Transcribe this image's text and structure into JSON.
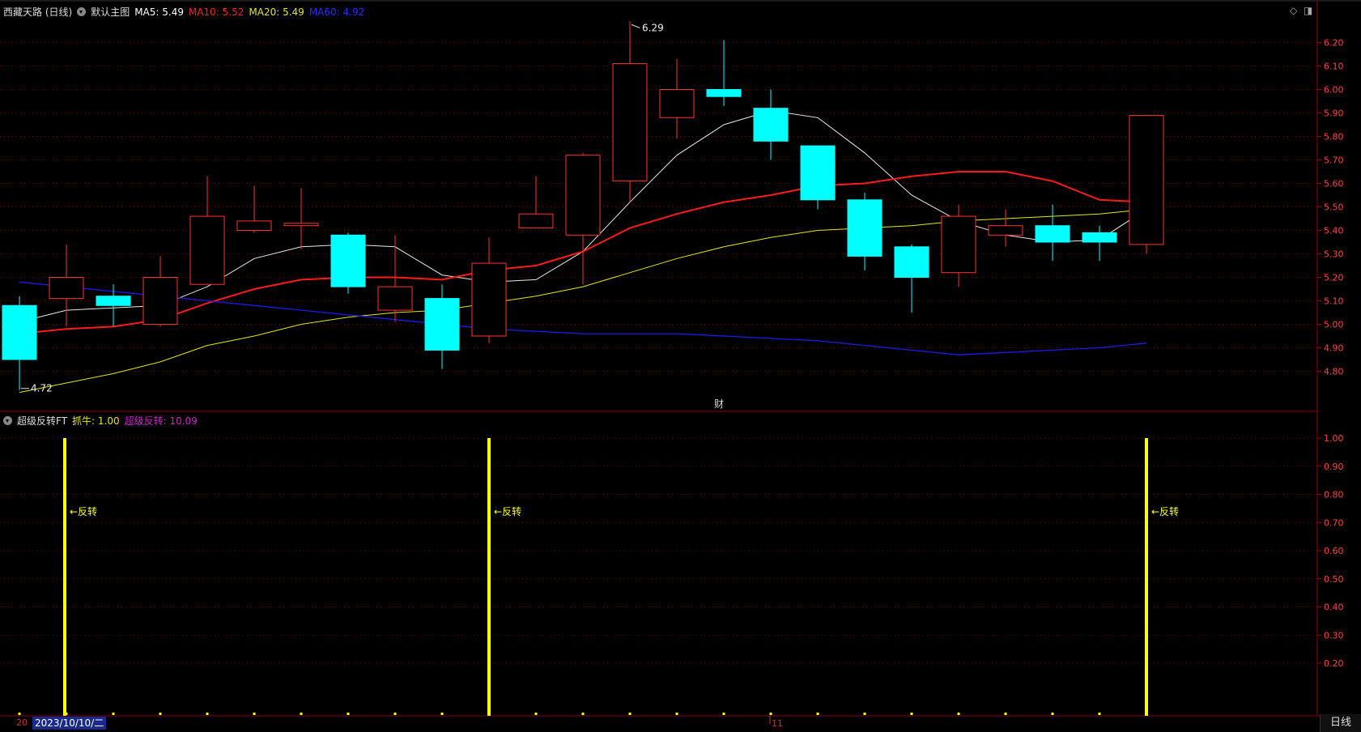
{
  "header": {
    "stock_name": "西藏天路 (日线)",
    "main_chart_label": "默认主图",
    "ma5": {
      "label": "MA5: 5.49",
      "color": "#ffffff"
    },
    "ma10": {
      "label": "MA10: 5.52",
      "color": "#ff2020"
    },
    "ma20": {
      "label": "MA20: 5.49",
      "color": "#e6e600"
    },
    "ma60": {
      "label": "MA60: 4.92",
      "color": "#1a1aff"
    }
  },
  "indicator_header": {
    "name": "超级反转FT",
    "zhuaniu": {
      "label": "抓牛: 1.00",
      "color": "#e6e600"
    },
    "chaoji": {
      "label": "超级反转: 10.09",
      "color": "#d020d0"
    }
  },
  "marks": {
    "high_label": "6.29",
    "low_label": "4.72",
    "cai_label": "财",
    "reversal_label": "←反转",
    "month_tick": "11"
  },
  "footer": {
    "date_prefix": "20",
    "selected_date": "2023/10/10/二",
    "period": "日线"
  },
  "colors": {
    "up": "#ff3030",
    "down": "#00ffff",
    "grid": "#7a0000",
    "axis_text": "#ff4040",
    "indicator_bar": "#ffff00"
  },
  "chart_data": {
    "type": "candlestick",
    "price_axis": {
      "ticks": [
        "6.20",
        "6.10",
        "6.00",
        "5.90",
        "5.80",
        "5.70",
        "5.60",
        "5.50",
        "5.40",
        "5.30",
        "5.20",
        "5.10",
        "5.00",
        "4.90",
        "4.80"
      ]
    },
    "candles": [
      {
        "open": 5.08,
        "close": 4.85,
        "high": 5.12,
        "low": 4.72
      },
      {
        "open": 5.11,
        "close": 5.2,
        "high": 5.34,
        "low": 4.99
      },
      {
        "open": 5.12,
        "close": 5.08,
        "high": 5.17,
        "low": 4.99
      },
      {
        "open": 5.0,
        "close": 5.2,
        "high": 5.29,
        "low": 4.99
      },
      {
        "open": 5.17,
        "close": 5.46,
        "high": 5.63,
        "low": 5.17
      },
      {
        "open": 5.4,
        "close": 5.44,
        "high": 5.59,
        "low": 5.39
      },
      {
        "open": 5.42,
        "close": 5.43,
        "high": 5.58,
        "low": 5.32
      },
      {
        "open": 5.38,
        "close": 5.16,
        "high": 5.39,
        "low": 5.13
      },
      {
        "open": 5.06,
        "close": 5.16,
        "high": 5.38,
        "low": 5.01
      },
      {
        "open": 5.11,
        "close": 4.89,
        "high": 5.17,
        "low": 4.81
      },
      {
        "open": 4.95,
        "close": 5.26,
        "high": 5.37,
        "low": 4.92
      },
      {
        "open": 5.41,
        "close": 5.47,
        "high": 5.63,
        "low": 5.41
      },
      {
        "open": 5.38,
        "close": 5.72,
        "high": 5.73,
        "low": 5.17
      },
      {
        "open": 5.61,
        "close": 6.11,
        "high": 6.29,
        "low": 5.52
      },
      {
        "open": 5.88,
        "close": 6.0,
        "high": 6.13,
        "low": 5.79
      },
      {
        "open": 6.0,
        "close": 5.97,
        "high": 6.21,
        "low": 5.93
      },
      {
        "open": 5.92,
        "close": 5.78,
        "high": 6.0,
        "low": 5.7
      },
      {
        "open": 5.76,
        "close": 5.53,
        "high": 5.76,
        "low": 5.49
      },
      {
        "open": 5.53,
        "close": 5.29,
        "high": 5.56,
        "low": 5.23
      },
      {
        "open": 5.33,
        "close": 5.2,
        "high": 5.34,
        "low": 5.05
      },
      {
        "open": 5.22,
        "close": 5.46,
        "high": 5.51,
        "low": 5.16
      },
      {
        "open": 5.38,
        "close": 5.42,
        "high": 5.49,
        "low": 5.33
      },
      {
        "open": 5.42,
        "close": 5.35,
        "high": 5.51,
        "low": 5.27
      },
      {
        "open": 5.39,
        "close": 5.35,
        "high": 5.42,
        "low": 5.27
      },
      {
        "open": 5.34,
        "close": 5.89,
        "high": 5.89,
        "low": 5.3
      }
    ],
    "series": [
      {
        "name": "MA5",
        "values": [
          5.01,
          5.06,
          5.07,
          5.08,
          5.16,
          5.28,
          5.33,
          5.34,
          5.33,
          5.21,
          5.18,
          5.19,
          5.31,
          5.52,
          5.72,
          5.85,
          5.91,
          5.88,
          5.73,
          5.55,
          5.44,
          5.38,
          5.35,
          5.36,
          5.49
        ]
      },
      {
        "name": "MA10",
        "values": [
          4.96,
          4.98,
          4.99,
          5.02,
          5.09,
          5.15,
          5.19,
          5.2,
          5.2,
          5.19,
          5.23,
          5.25,
          5.31,
          5.41,
          5.47,
          5.52,
          5.55,
          5.59,
          5.6,
          5.63,
          5.65,
          5.65,
          5.61,
          5.53,
          5.52
        ]
      },
      {
        "name": "MA20",
        "values": [
          4.71,
          4.75,
          4.79,
          4.84,
          4.91,
          4.95,
          5.0,
          5.03,
          5.05,
          5.06,
          5.09,
          5.12,
          5.16,
          5.22,
          5.28,
          5.33,
          5.37,
          5.4,
          5.41,
          5.42,
          5.44,
          5.45,
          5.46,
          5.47,
          5.49
        ]
      },
      {
        "name": "MA60",
        "values": [
          5.18,
          5.16,
          5.14,
          5.12,
          5.1,
          5.08,
          5.06,
          5.04,
          5.02,
          5.0,
          4.98,
          4.97,
          4.96,
          4.96,
          4.96,
          4.95,
          4.94,
          4.93,
          4.91,
          4.89,
          4.87,
          4.88,
          4.89,
          4.9,
          4.92
        ]
      }
    ],
    "indicator": {
      "axis_ticks": [
        "1.00",
        "0.90",
        "0.80",
        "0.70",
        "0.60",
        "0.50",
        "0.40",
        "0.30",
        "0.20"
      ],
      "signals": [
        1,
        10,
        24
      ]
    }
  }
}
